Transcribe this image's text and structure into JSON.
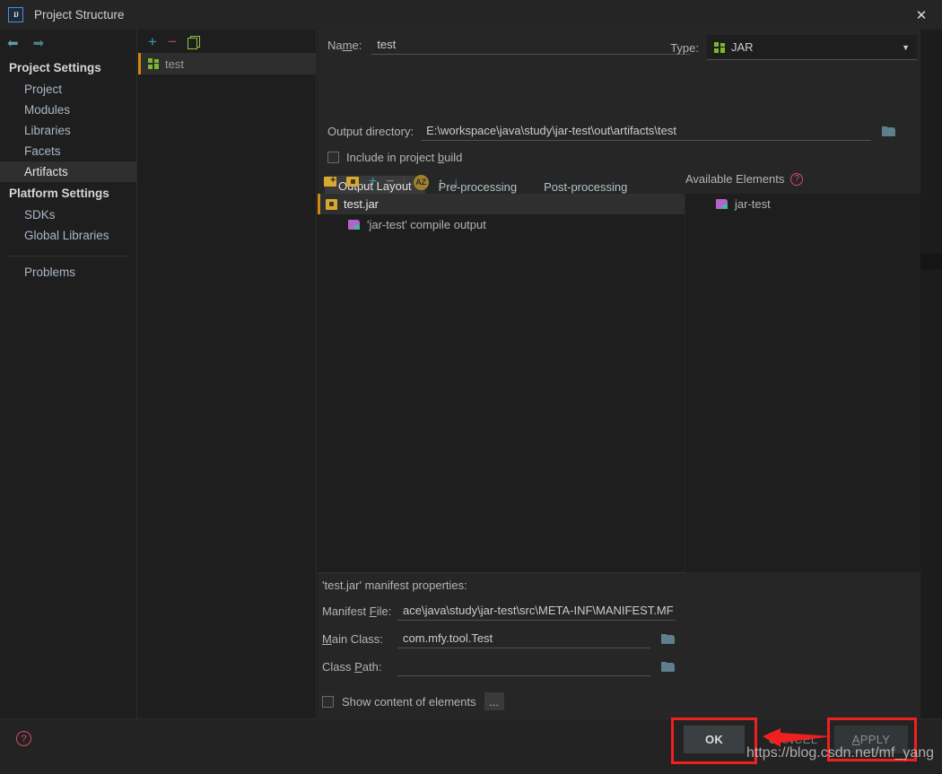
{
  "window": {
    "title": "Project Structure",
    "logo_text": "IJ",
    "close_icon": "close-icon"
  },
  "nav": {
    "back_icon": "arrow-left-icon",
    "forward_icon": "arrow-right-icon"
  },
  "sidebar": {
    "project_settings_title": "Project Settings",
    "platform_settings_title": "Platform Settings",
    "project_items": [
      {
        "label": "Project",
        "selected": false
      },
      {
        "label": "Modules",
        "selected": false
      },
      {
        "label": "Libraries",
        "selected": false
      },
      {
        "label": "Facets",
        "selected": false
      },
      {
        "label": "Artifacts",
        "selected": true
      }
    ],
    "platform_items": [
      {
        "label": "SDKs",
        "selected": false
      },
      {
        "label": "Global Libraries",
        "selected": false
      }
    ],
    "other_items": [
      {
        "label": "Problems",
        "selected": false
      }
    ]
  },
  "artifacts_panel": {
    "toolbar": {
      "add_label": "+",
      "remove_label": "−",
      "copy_icon": "copy-icon"
    },
    "items": [
      {
        "label": "test",
        "selected": true,
        "icon": "jar-artifact-icon"
      }
    ]
  },
  "editor": {
    "name_label": "Name:",
    "name_value": "test",
    "type_label": "Type:",
    "type_value": "JAR",
    "type_caret": "▼",
    "output_directory_label": "Output directory:",
    "output_directory_value": "E:\\workspace\\java\\study\\jar-test\\out\\artifacts\\test",
    "output_directory_browse_icon": "folder-icon",
    "include_in_build_label": "Include in project build",
    "include_in_build_checked": false,
    "tabs": [
      {
        "label": "Output Layout",
        "active": true
      },
      {
        "label": "Pre-processing",
        "active": false
      },
      {
        "label": "Post-processing",
        "active": false
      }
    ]
  },
  "layout_toolbar": {
    "add_directory_icon": "add-directory-icon",
    "add_archive_icon": "add-archive-icon",
    "add_label": "+",
    "remove_label": "−",
    "sort_label": "AZ",
    "move_up_label": "↑",
    "move_down_label": "↓"
  },
  "output_layout_tree": [
    {
      "label": "test.jar",
      "icon": "jar-file-icon",
      "selected": true,
      "child": false
    },
    {
      "label": "'jar-test' compile output",
      "icon": "module-output-icon",
      "selected": false,
      "child": true
    }
  ],
  "available_elements": {
    "header": "Available Elements",
    "help_icon": "help-icon",
    "items": [
      {
        "label": "jar-test",
        "icon": "module-output-icon"
      }
    ]
  },
  "manifest": {
    "section_title": "'test.jar' manifest properties:",
    "manifest_file_label": "Manifest File:",
    "manifest_file_value": "ace\\java\\study\\jar-test\\src\\META-INF\\MANIFEST.MF",
    "main_class_label": "Main Class:",
    "main_class_value": "com.mfy.tool.Test",
    "main_class_browse_icon": "folder-icon",
    "class_path_label": "Class Path:",
    "class_path_value": "",
    "class_path_browse_icon": "folder-icon",
    "show_content_label": "Show content of elements",
    "show_content_checked": false,
    "ellipsis_button_label": "..."
  },
  "footer": {
    "help_icon": "help-icon",
    "ok_label": "OK",
    "cancel_label": "CANCEL",
    "apply_label": "APPLY"
  },
  "annotations": {
    "watermark": "https://blog.csdn.net/mf_yang",
    "highlight_color": "#f02020",
    "arrow_icon": "left-arrow-annotation"
  }
}
